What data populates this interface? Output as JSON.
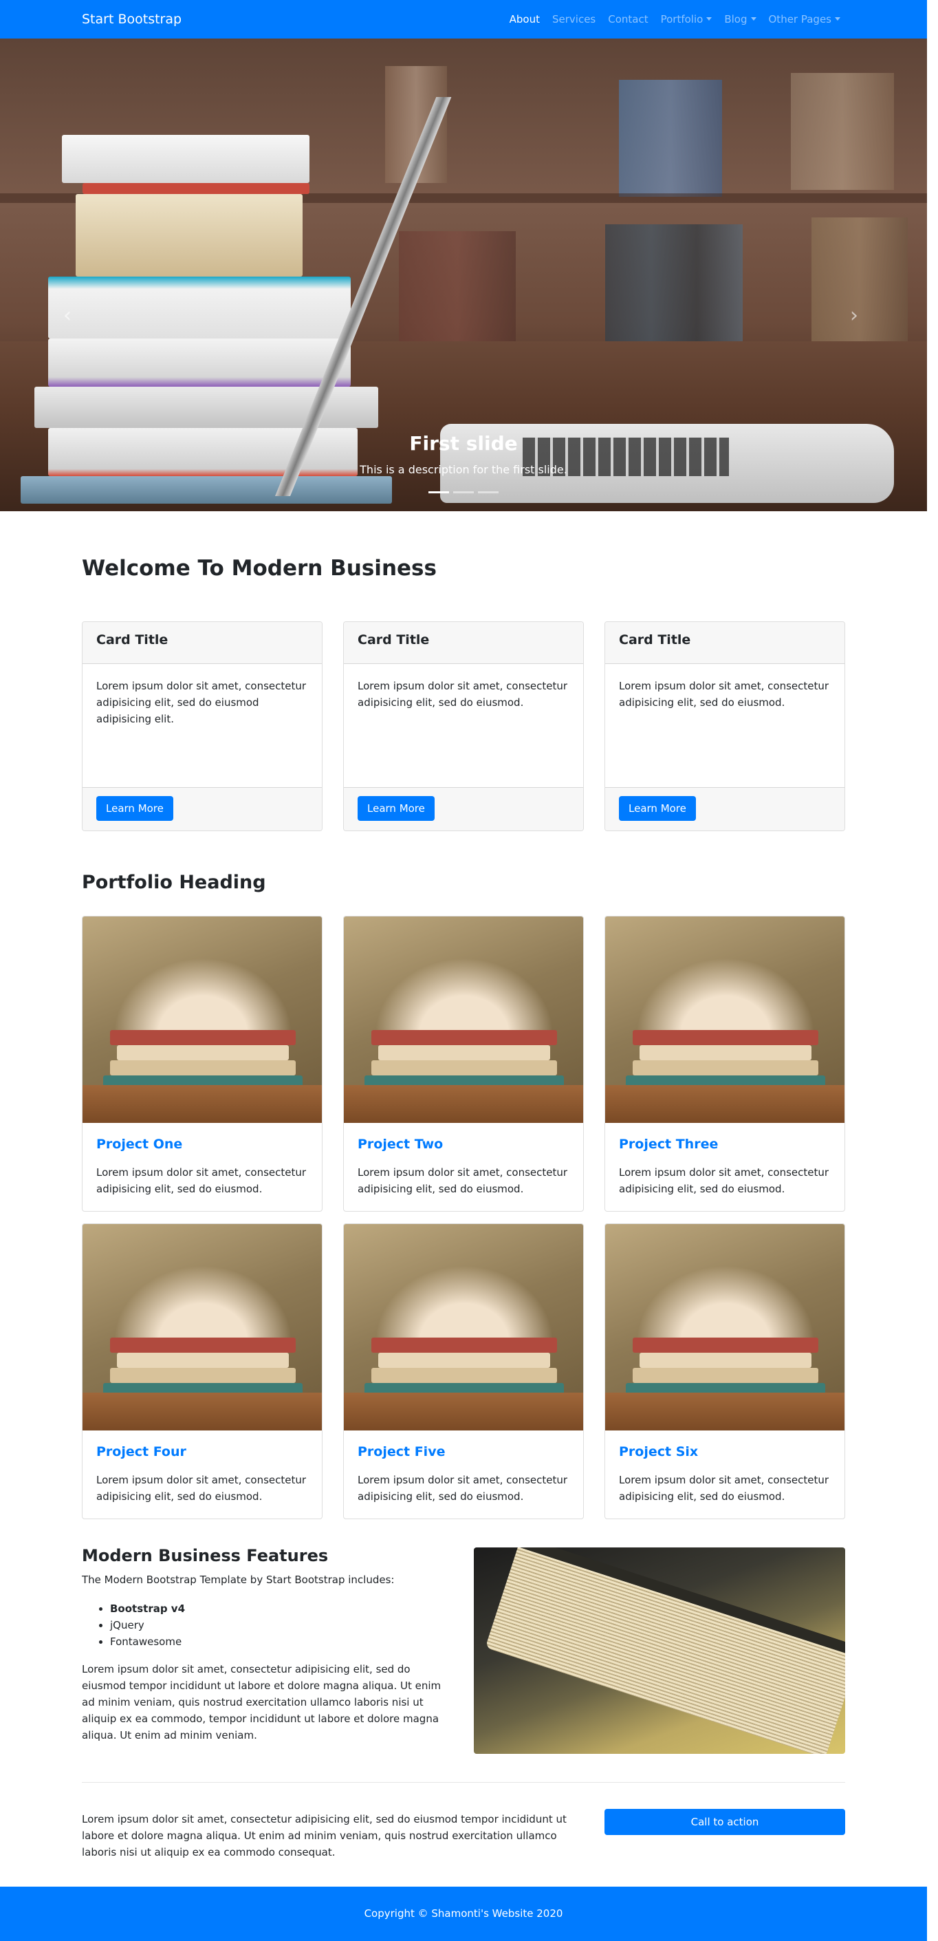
{
  "navbar": {
    "brand": "Start Bootstrap",
    "links": [
      {
        "label": "About",
        "active": true,
        "dropdown": false
      },
      {
        "label": "Services",
        "active": false,
        "dropdown": false
      },
      {
        "label": "Contact",
        "active": false,
        "dropdown": false
      },
      {
        "label": "Portfolio",
        "active": false,
        "dropdown": true
      },
      {
        "label": "Blog",
        "active": false,
        "dropdown": true
      },
      {
        "label": "Other Pages",
        "active": false,
        "dropdown": true
      }
    ]
  },
  "carousel": {
    "title": "First slide",
    "description": "This is a description for the first slide.",
    "active_index": 0,
    "slide_count": 3
  },
  "welcome": {
    "heading": "Welcome To Modern Business",
    "cards": [
      {
        "title": "Card Title",
        "body": "Lorem ipsum dolor sit amet, consectetur adipisicing elit, sed do eiusmod adipisicing elit.",
        "button": "Learn More"
      },
      {
        "title": "Card Title",
        "body": "Lorem ipsum dolor sit amet, consectetur adipisicing elit, sed do eiusmod.",
        "button": "Learn More"
      },
      {
        "title": "Card Title",
        "body": "Lorem ipsum dolor sit amet, consectetur adipisicing elit, sed do eiusmod.",
        "button": "Learn More"
      }
    ]
  },
  "portfolio": {
    "heading": "Portfolio Heading",
    "projects": [
      {
        "title": "Project One",
        "body": "Lorem ipsum dolor sit amet, consectetur adipisicing elit, sed do eiusmod."
      },
      {
        "title": "Project Two",
        "body": "Lorem ipsum dolor sit amet, consectetur adipisicing elit, sed do eiusmod."
      },
      {
        "title": "Project Three",
        "body": "Lorem ipsum dolor sit amet, consectetur adipisicing elit, sed do eiusmod."
      },
      {
        "title": "Project Four",
        "body": "Lorem ipsum dolor sit amet, consectetur adipisicing elit, sed do eiusmod."
      },
      {
        "title": "Project Five",
        "body": "Lorem ipsum dolor sit amet, consectetur adipisicing elit, sed do eiusmod."
      },
      {
        "title": "Project Six",
        "body": "Lorem ipsum dolor sit amet, consectetur adipisicing elit, sed do eiusmod."
      }
    ]
  },
  "features": {
    "heading": "Modern Business Features",
    "intro": "The Modern Bootstrap Template by Start Bootstrap includes:",
    "items": [
      {
        "label": "Bootstrap v4",
        "bold": true
      },
      {
        "label": "jQuery",
        "bold": false
      },
      {
        "label": "Fontawesome",
        "bold": false
      }
    ],
    "paragraph": "Lorem ipsum dolor sit amet, consectetur adipisicing elit, sed do eiusmod tempor incididunt ut labore et dolore magna aliqua. Ut enim ad minim veniam, quis nostrud exercitation ullamco laboris nisi ut aliquip ex ea commodo, tempor incididunt ut labore et dolore magna aliqua. Ut enim ad minim veniam."
  },
  "cta": {
    "text": "Lorem ipsum dolor sit amet, consectetur adipisicing elit, sed do eiusmod tempor incididunt ut labore et dolore magna aliqua. Ut enim ad minim veniam, quis nostrud exercitation ullamco laboris nisi ut aliquip ex ea commodo consequat.",
    "button": "Call to action"
  },
  "footer": {
    "copyright": "Copyright © Shamonti's Website 2020"
  },
  "colors": {
    "primary": "#007bff",
    "card_header_bg": "#f7f7f7"
  }
}
